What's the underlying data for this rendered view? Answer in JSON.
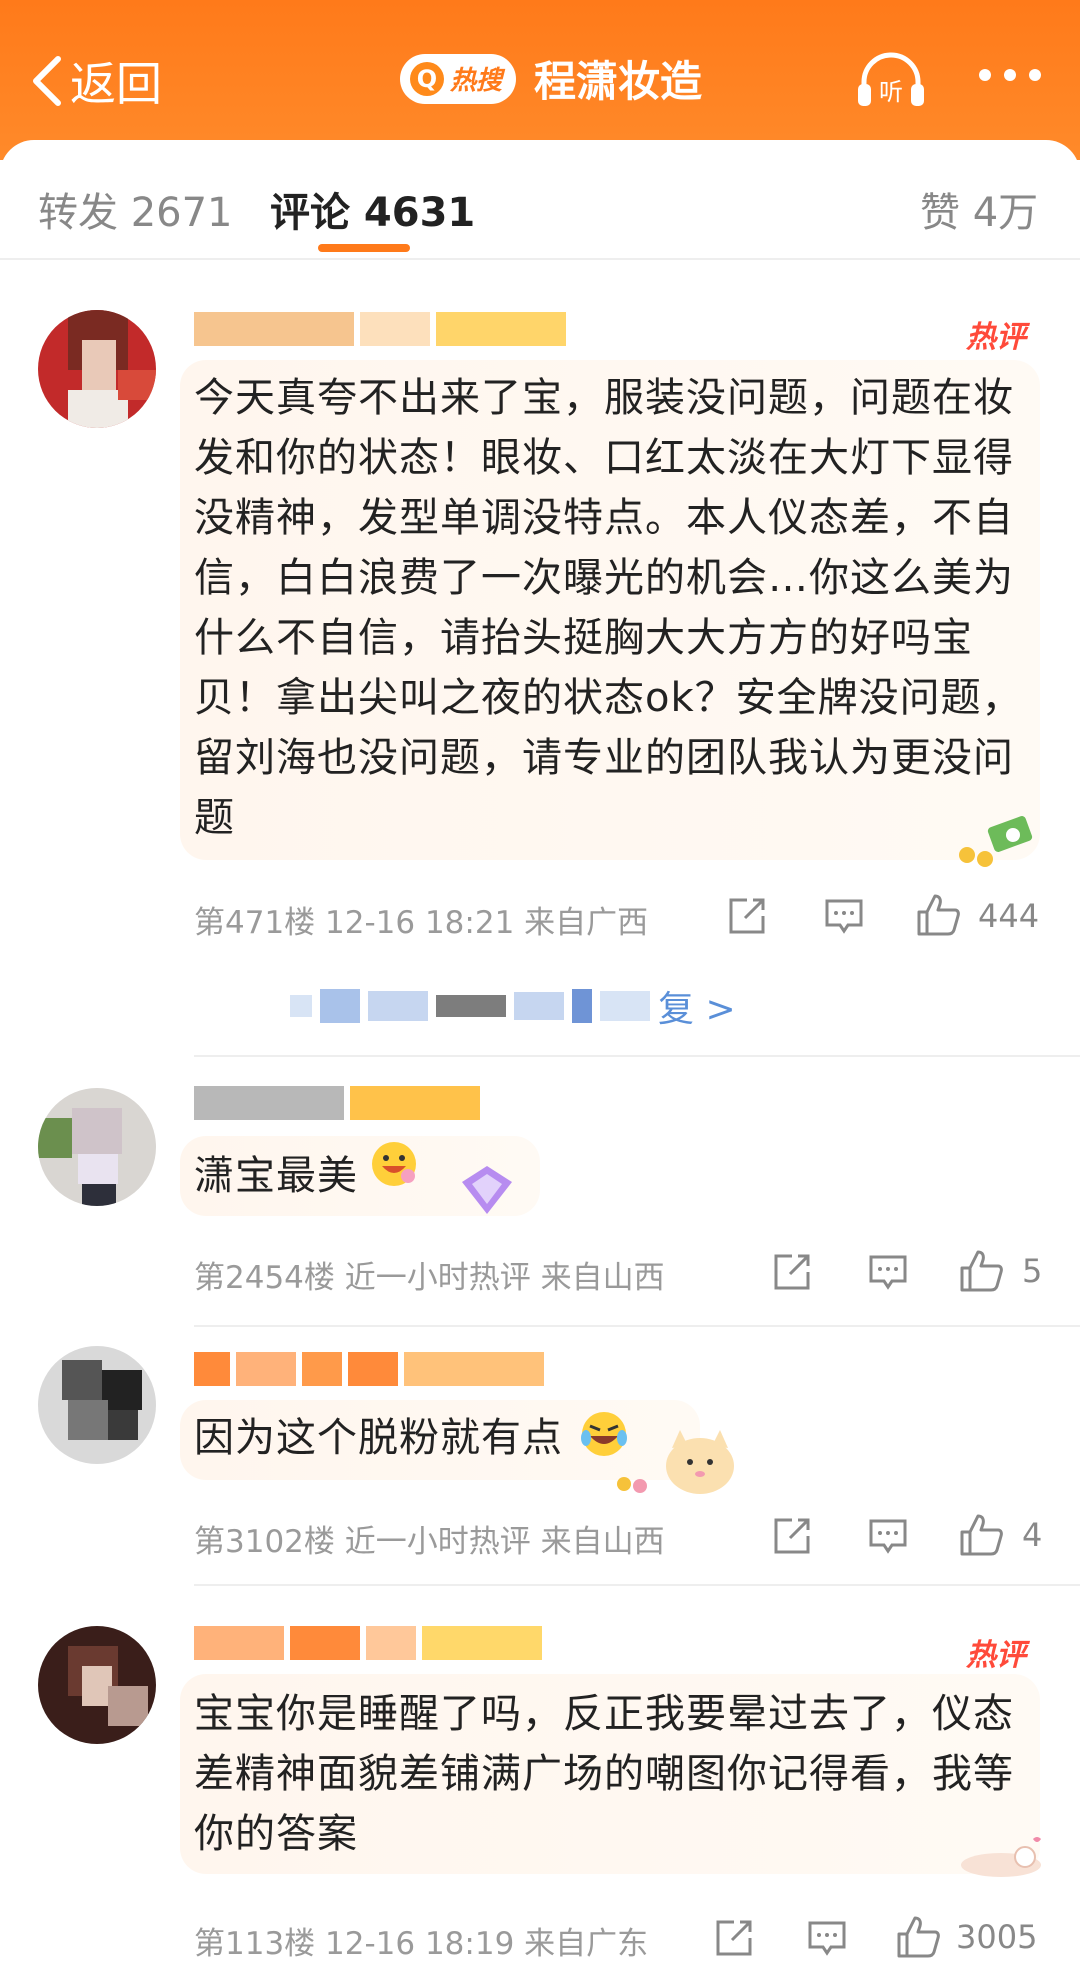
{
  "header": {
    "back_label": "返回",
    "hot_badge": "热搜",
    "title": "程潇妆造",
    "listen_label": "听"
  },
  "tabs": [
    {
      "label": "转发 2671"
    },
    {
      "label": "评论 4631"
    },
    {
      "label": "赞 4万"
    }
  ],
  "comments": [
    {
      "hot_tag": "热评",
      "text": "今天真夸不出来了宝，服装没问题，问题在妆发和你的状态！眼妆、口红太淡在大灯下显得没精神，发型单调没特点。本人仪态差，不自信，白白浪费了一次曝光的机会…你这么美为什么不自信，请抬头挺胸大大方方的好吗宝贝！拿出尖叫之夜的状态ok？安全牌没问题，留刘海也没问题，请专业的团队我认为更没问题",
      "meta": "第471楼 12-16 18:21 来自广西",
      "likes": "444",
      "reply_link": "复 >"
    },
    {
      "text": "潇宝最美",
      "meta": "第2454楼 近一小时热评 来自山西",
      "likes": "5"
    },
    {
      "text": "因为这个脱粉就有点",
      "meta": "第3102楼 近一小时热评 来自山西",
      "likes": "4"
    },
    {
      "hot_tag": "热评",
      "text": "宝宝你是睡醒了吗，反正我要晕过去了，仪态差精神面貌差铺满广场的嘲图你记得看，我等你的答案",
      "meta": "第113楼 12-16 18:19 来自广东",
      "likes": "3005"
    }
  ],
  "colors": {
    "brand_orange": "#ff7a1a",
    "hot_red": "#ff4a3a",
    "link_blue": "#5a8fd8"
  }
}
